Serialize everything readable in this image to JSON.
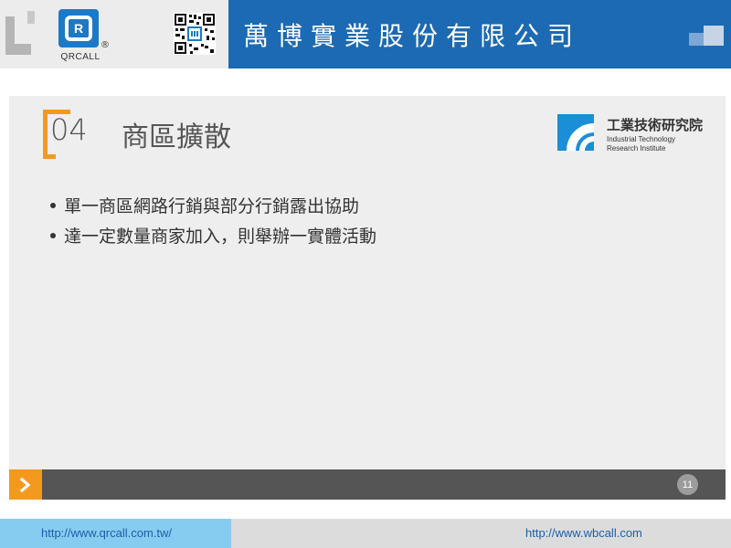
{
  "header": {
    "brand_logo_text": "QRCALL",
    "brand_logo_letter": "R",
    "brand_logo_reg": "®",
    "company_name": "萬博實業股份有限公司",
    "brand_color": "#1c79c7",
    "banner_color": "#1c6ab3"
  },
  "slide": {
    "section_number": "04",
    "section_title": "商區擴散",
    "accent_color": "#f39a1e",
    "partner_logo": {
      "name_cn": "工業技術研究院",
      "name_en_line1": "Industrial Technology",
      "name_en_line2": "Research Institute"
    },
    "bullets": [
      "單一商區網路行銷與部分行銷露出協助",
      "達一定數量商家加入，則舉辦一實體活動"
    ],
    "page_number": "11"
  },
  "footer": {
    "link_left": "http://www.qrcall.com.tw/",
    "link_right": "http://www.wbcall.com"
  }
}
